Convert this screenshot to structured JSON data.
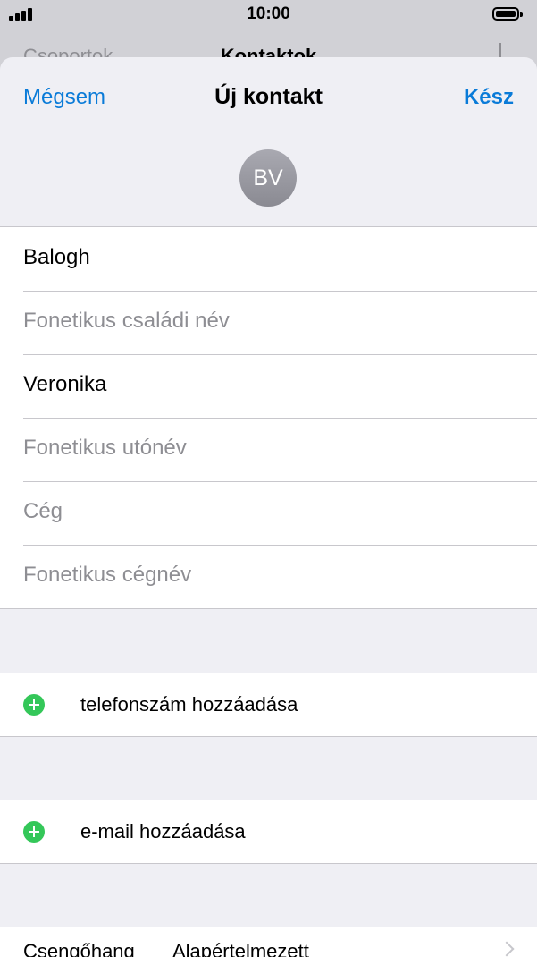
{
  "status": {
    "time": "10:00"
  },
  "background_nav": {
    "left": "Csoportok",
    "title": "Kontaktok"
  },
  "navbar": {
    "cancel": "Mégsem",
    "title": "Új kontakt",
    "done": "Kész"
  },
  "avatar": {
    "initials": "BV"
  },
  "name_fields": [
    {
      "value": "Balogh",
      "placeholder": ""
    },
    {
      "value": "",
      "placeholder": "Fonetikus családi név"
    },
    {
      "value": "Veronika",
      "placeholder": ""
    },
    {
      "value": "",
      "placeholder": "Fonetikus utónév"
    },
    {
      "value": "",
      "placeholder": "Cég"
    },
    {
      "value": "",
      "placeholder": "Fonetikus cégnév"
    }
  ],
  "add_phone": "telefonszám hozzáadása",
  "add_email": "e-mail hozzáadása",
  "ringtone": {
    "label": "Csengőhang",
    "value": "Alapértelmezett"
  }
}
